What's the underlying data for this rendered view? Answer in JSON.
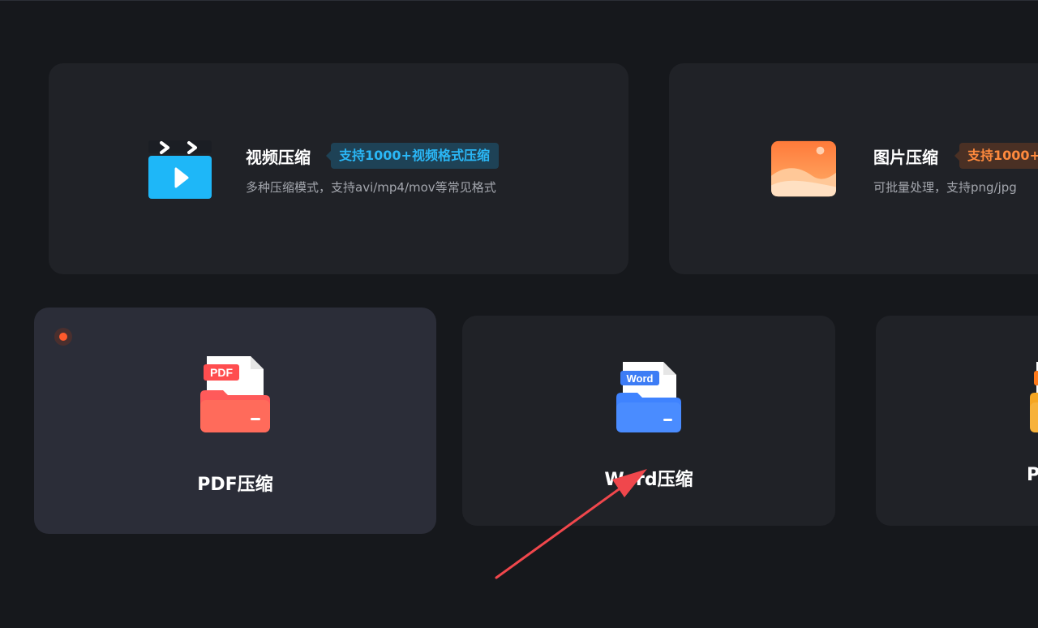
{
  "video_card": {
    "title": "视频压缩",
    "tag": "支持1000+视频格式压缩",
    "description": "多种压缩模式，支持avi/mp4/mov等常见格式",
    "tag_color": "#2ab7f6"
  },
  "image_card": {
    "title": "图片压缩",
    "tag": "支持1000+",
    "description": "可批量处理，支持png/jpg",
    "tag_color": "#ff8a3d"
  },
  "doc_cards": [
    {
      "label": "PDF压缩",
      "icon": "pdf-file-icon",
      "badge": "PDF",
      "color": "#ff5a5a"
    },
    {
      "label": "Word压缩",
      "icon": "word-file-icon",
      "badge": "Word",
      "color": "#3f83ff"
    },
    {
      "label": "P",
      "icon": "ppt-file-icon",
      "color": "#f5a623"
    }
  ],
  "annotation": {
    "icon": "red-arrow-icon",
    "color": "#f0474c"
  }
}
